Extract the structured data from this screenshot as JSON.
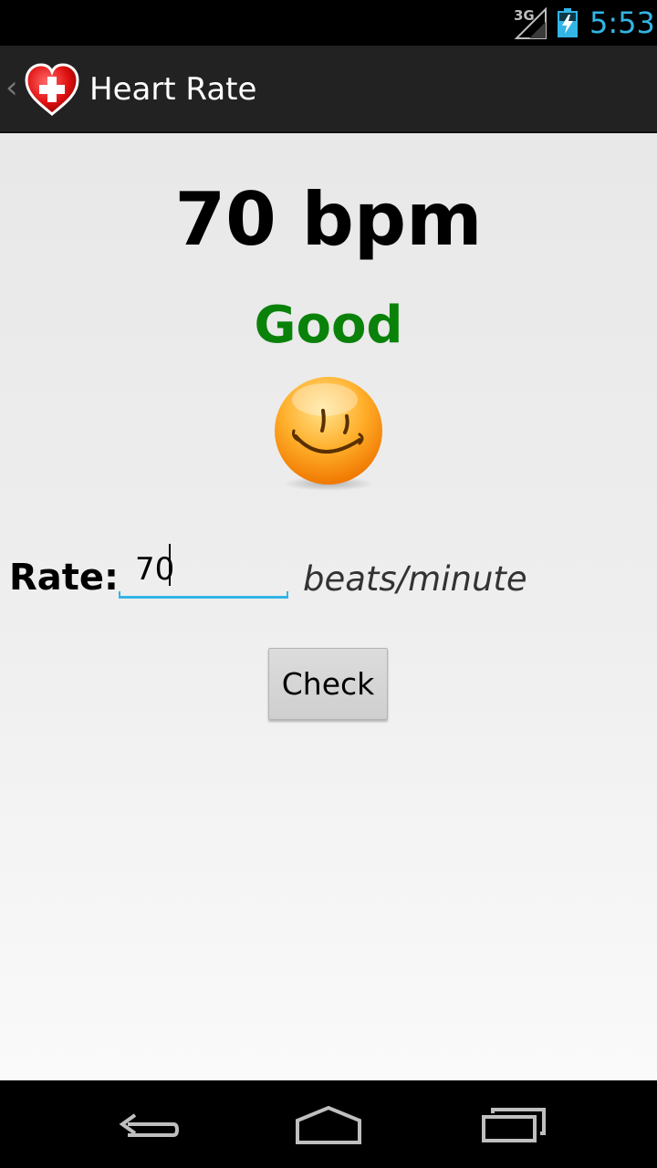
{
  "status_bar": {
    "network": "3G",
    "time": "5:53"
  },
  "action_bar": {
    "title": "Heart Rate",
    "app_icon": "heart-cross-icon"
  },
  "main": {
    "bpm_display": "70 bpm",
    "status_text": "Good",
    "status_color": "#0a820a",
    "mood_icon": "smiley-icon",
    "rate_label": "Rate:",
    "rate_value": "70",
    "units_label": "beats/minute",
    "check_button_label": "Check"
  },
  "nav_bar": {
    "back": "back-icon",
    "home": "home-icon",
    "recents": "recents-icon"
  },
  "colors": {
    "accent": "#33b5e5",
    "action_bar_bg": "#222222"
  }
}
